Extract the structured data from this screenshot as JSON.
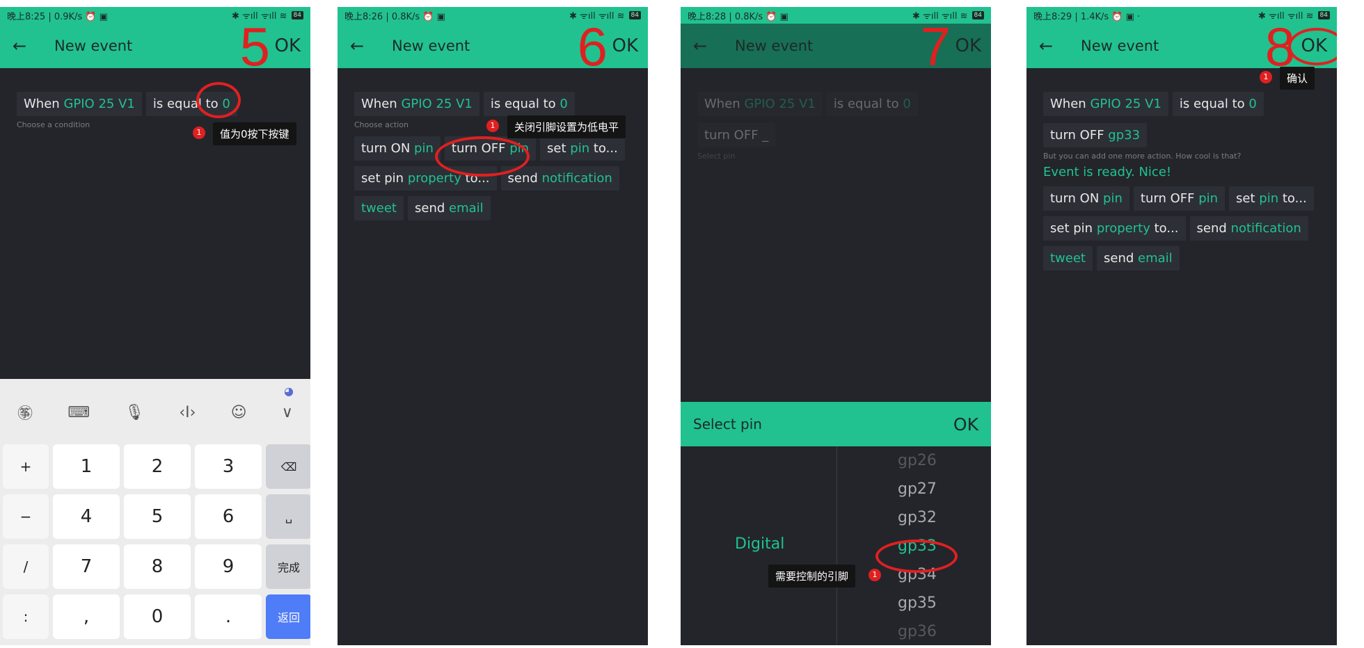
{
  "common": {
    "back_arrow": "←",
    "title": "New event",
    "ok": "OK",
    "when_prefix": "When",
    "pin_name": "GPIO 25 V1",
    "is_equal_prefix": "is equal to",
    "value": "0"
  },
  "panel1": {
    "status_left": "晚上8:25 | 0.9K/s ⏰ ▣",
    "step": "5",
    "hint": "Choose a condition",
    "tooltip": "值为0按下按键",
    "badge": "1",
    "keyboard": {
      "tools": [
        "㉇",
        "⌨",
        "🎙",
        "‹I›",
        "☺",
        "∨"
      ],
      "assistant_icon": "◕",
      "keys": [
        "+",
        "1",
        "2",
        "3",
        "⌫",
        "−",
        "4",
        "5",
        "6",
        "␣",
        "/",
        "7",
        "8",
        "9",
        "完成",
        ":",
        ",",
        "0",
        ".",
        "返回"
      ]
    }
  },
  "panel2": {
    "status_left": "晚上8:26 | 0.8K/s ⏰ ▣",
    "step": "6",
    "hint": "Choose action",
    "tooltip": "关闭引脚设置为低电平",
    "badge": "1",
    "actions": [
      {
        "a": "turn ON",
        "b": "pin"
      },
      {
        "a": "turn OFF",
        "b": "pin"
      },
      {
        "a": "set",
        "b": "pin",
        "c": "to..."
      },
      {
        "a": "set pin",
        "b": "property",
        "c": "to..."
      },
      {
        "a": "send",
        "b": "notification"
      },
      {
        "a": "",
        "b": "tweet"
      },
      {
        "a": "send",
        "b": "email"
      }
    ]
  },
  "panel3": {
    "status_left": "晚上8:28 | 0.8K/s ⏰ ▣",
    "step": "7",
    "turn_off": "turn OFF _",
    "hint": "Select pin",
    "select_title": "Select pin",
    "category": "Digital",
    "pins": [
      "gp26",
      "gp27",
      "gp32",
      "gp33",
      "gp34",
      "gp35",
      "gp36"
    ],
    "tooltip": "需要控制的引脚",
    "badge": "1"
  },
  "panel4": {
    "status_left": "晚上8:29 | 1.4K/s ⏰ ▣ ·",
    "step": "8",
    "turn_off_prefix": "turn OFF",
    "turn_off_pin": "gp33",
    "hint": "But you can add one more action. How cool is that?",
    "ready": "Event is ready. Nice!",
    "tooltip": "确认",
    "badge": "1"
  },
  "status_right": "✱ ᯤıll ᯤıll ≋",
  "battery": "84",
  "colors": {
    "accent": "#21c28f",
    "background": "#23252b",
    "annotation": "#e02020"
  }
}
